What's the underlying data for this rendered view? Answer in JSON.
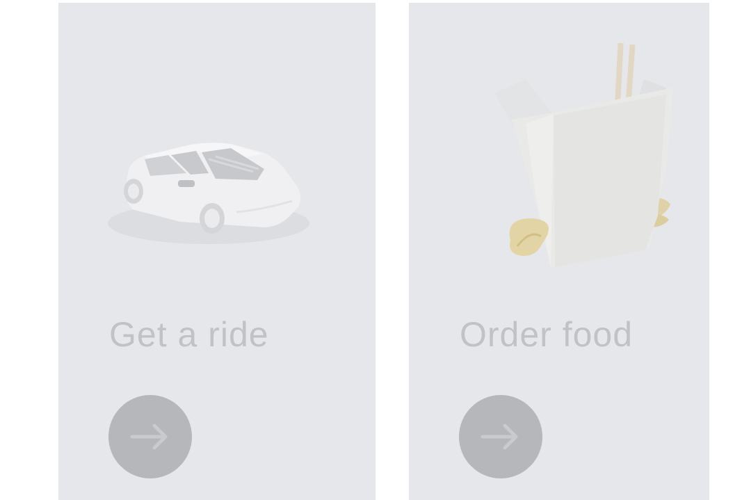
{
  "cards": [
    {
      "title": "Get a ride",
      "illustration": "car-icon",
      "action_icon": "arrow-right-icon"
    },
    {
      "title": "Order food",
      "illustration": "takeout-box-icon",
      "action_icon": "arrow-right-icon"
    }
  ],
  "colors": {
    "card_background": "#e6e7ea",
    "title_text": "#c1c2c6",
    "button_fill": "#b6b7bb",
    "arrow_stroke": "#c9cacd"
  }
}
